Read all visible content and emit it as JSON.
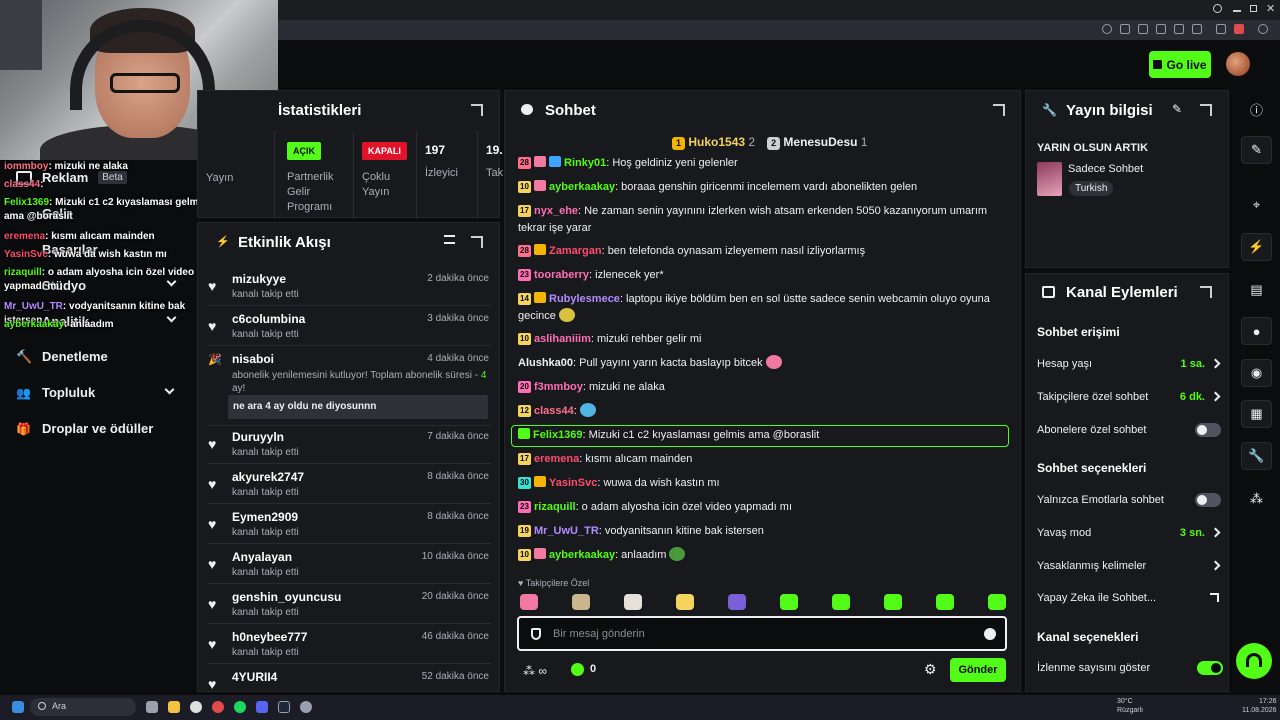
{
  "header": {
    "go_live": "Go live"
  },
  "sidebar": {
    "items": [
      {
        "label": "Reklam",
        "badge": "Beta"
      },
      {
        "label": "Gelir"
      },
      {
        "label": "Başarılar"
      },
      {
        "label": "Stüdyo"
      },
      {
        "label": "Analitik"
      },
      {
        "label": "Denetleme"
      },
      {
        "label": "Topluluk"
      },
      {
        "label": "Droplar ve ödüller"
      }
    ]
  },
  "overlay_chat": [
    {
      "name": "iommboy",
      "color": "#ff6e8a",
      "text": ": mizuki ne alaka"
    },
    {
      "name": "class44",
      "color": "#ff6e8a",
      "text": ":"
    },
    {
      "name": "Felix1369",
      "color": "#53fc18",
      "text": ": Mizuki c1 c2 kıyaslaması gelmis ama @boraslit"
    },
    {
      "name": "eremena",
      "color": "#ff4d6d",
      "text": ": kısmı alıcam mainden"
    },
    {
      "name": "YasinSvc",
      "color": "#ff4d6d",
      "text": ": wuwa da wish kastın mı"
    },
    {
      "name": "rizaquill",
      "color": "#53fc18",
      "text": ": o adam alyosha icin özel video yapmadı mı"
    },
    {
      "name": "Mr_UwU_TR",
      "color": "#b18cff",
      "text": ": vodyanitsanın kitine bak istersen"
    },
    {
      "name": "ayberkaakay",
      "color": "#53fc18",
      "text": ": anlaadım"
    }
  ],
  "stats": {
    "title": "İstatistikleri",
    "yayin_label": "Yayın",
    "partner": {
      "badge": "AÇIK",
      "label": "Partnerlik Gelir Programı"
    },
    "multi": {
      "badge": "KAPALI",
      "label": "Çoklu Yayın"
    },
    "viewers": {
      "value": "197",
      "label": "İzleyici"
    },
    "extra": {
      "value": "19.",
      "label": "Tak"
    }
  },
  "activity": {
    "title": "Etkinlik Akışı",
    "items": [
      {
        "user": "mizukyye",
        "sub": "kanalı takip etti",
        "time": "2 dakika önce"
      },
      {
        "user": "c6columbina",
        "sub": "kanalı takip etti",
        "time": "3 dakika önce"
      },
      {
        "user": "nisaboi",
        "sub": "abonelik yenilemesini kutluyor! Toplam abonelik süresi - ",
        "sub_highlight": "4",
        "sub_tail": "ay!",
        "message": "ne ara 4 ay oldu ne diyosunnn",
        "time": "4 dakika önce"
      },
      {
        "user": "Duruyyln",
        "sub": "kanalı takip etti",
        "time": "7 dakika önce"
      },
      {
        "user": "akyurek2747",
        "sub": "kanalı takip etti",
        "time": "8 dakika önce"
      },
      {
        "user": "Eymen2909",
        "sub": "kanalı takip etti",
        "time": "8 dakika önce"
      },
      {
        "user": "Anyalayan",
        "sub": "kanalı takip etti",
        "time": "10 dakika önce"
      },
      {
        "user": "genshin_oyuncusu",
        "sub": "kanalı takip etti",
        "time": "20 dakika önce"
      },
      {
        "user": "h0neybee777",
        "sub": "kanalı takip etti",
        "time": "46 dakika önce"
      },
      {
        "user": "4YURII4",
        "sub": "",
        "time": "52 dakika önce"
      }
    ]
  },
  "chat": {
    "title": "Sohbet",
    "top_gifters": [
      {
        "rank": "1",
        "name": "Huko1543",
        "count": "2"
      },
      {
        "rank": "2",
        "name": "MenesuDesu",
        "count": "1"
      }
    ],
    "messages": [
      {
        "level": "28",
        "lvl_color": "#ff6e8a",
        "name": "Rinky01",
        "name_color": "#53fc18",
        "text": ": Hoş geldiniz yeni gelenler"
      },
      {
        "level": "10",
        "lvl_color": "#f4d35e",
        "name": "ayberkaakay",
        "name_color": "#53fc18",
        "text": ": boraaa genshin giricenmi incelemem vardı abonelikten gelen"
      },
      {
        "level": "17",
        "lvl_color": "#f4d35e",
        "name": "nyx_ehe",
        "name_color": "#ff6eb4",
        "text": ": Ne zaman senin yayınını izlerken wish atsam erkenden 5050 kazanıyorum umarım tekrar işe yarar"
      },
      {
        "level": "28",
        "lvl_color": "#ff6e8a",
        "name": "Zamargan",
        "name_color": "#ff4d6d",
        "text": ": ben telefonda oynasam izleyemem nasıl izliyorlarmış"
      },
      {
        "level": "23",
        "lvl_color": "#ff6eb4",
        "name": "tooraberry",
        "name_color": "#ff6eb4",
        "text": ": izlenecek yer*"
      },
      {
        "level": "14",
        "lvl_color": "#f4d35e",
        "name": "Rubylesmece",
        "name_color": "#b18cff",
        "text": ": laptopu ikiye böldüm ben en sol üstte sadece senin webcamin oluyo oyuna gecince"
      },
      {
        "level": "10",
        "lvl_color": "#f4d35e",
        "name": "aslihaniiim",
        "name_color": "#ff6eb4",
        "text": ": mizuki rehber gelir mi"
      },
      {
        "level": "",
        "lvl_color": "",
        "name": "Alushka00",
        "name_color": "#efeff1",
        "text": ": Pull yayını yarın kacta baslayıp bitcek"
      },
      {
        "level": "20",
        "lvl_color": "#ff6eb4",
        "name": "f3mmboy",
        "name_color": "#ff6eb4",
        "text": ": mizuki ne alaka"
      },
      {
        "level": "12",
        "lvl_color": "#f4d35e",
        "name": "class44",
        "name_color": "#ff6e8a",
        "text": ":"
      },
      {
        "level": "",
        "lvl_color": "",
        "name": "Felix1369",
        "name_color": "#53fc18",
        "text": ": Mizuki c1 c2 kıyaslaması gelmis ama @boraslit"
      },
      {
        "level": "17",
        "lvl_color": "#f4d35e",
        "name": "eremena",
        "name_color": "#ff4d6d",
        "text": ": kısmı alıcam mainden"
      },
      {
        "level": "30",
        "lvl_color": "#3ee0d0",
        "name": "YasinSvc",
        "name_color": "#ff4d6d",
        "text": ": wuwa da wish kastın mı"
      },
      {
        "level": "23",
        "lvl_color": "#ff6eb4",
        "name": "rizaquill",
        "name_color": "#53fc18",
        "text": ": o adam alyosha icin özel video yapmadı mı"
      },
      {
        "level": "19",
        "lvl_color": "#f4d35e",
        "name": "Mr_UwU_TR",
        "name_color": "#b18cff",
        "text": ": vodyanitsanın kitine bak istersen"
      },
      {
        "level": "10",
        "lvl_color": "#f4d35e",
        "name": "ayberkaakay",
        "name_color": "#53fc18",
        "text": ": anlaadım"
      }
    ],
    "followers_only_label": "Takipçilere Özel",
    "input_placeholder": "Bir mesaj gönderin",
    "points": "0",
    "send": "Gönder"
  },
  "stream_info": {
    "title": "Yayın bilgisi",
    "stream_title": "YARIN OLSUN ARTIK",
    "category": "Sadece Sohbet",
    "language": "Turkish"
  },
  "channel_actions": {
    "title": "Kanal Eylemleri",
    "chat_access_title": "Sohbet erişimi",
    "account_age": {
      "label": "Hesap yaşı",
      "value": "1 sa."
    },
    "followers_chat": {
      "label": "Takipçilere özel sohbet",
      "value": "6 dk."
    },
    "subs_chat": {
      "label": "Abonelere özel sohbet"
    },
    "chat_options_title": "Sohbet seçenekleri",
    "emote_only": {
      "label": "Yalnızca Emotlarla sohbet"
    },
    "slow_mode": {
      "label": "Yavaş mod",
      "value": "3 sn."
    },
    "banned_words": {
      "label": "Yasaklanmış kelimeler"
    },
    "ai_chat": {
      "label": "Yapay Zeka ile Sohbet..."
    },
    "channel_options_title": "Kanal seçenekleri",
    "show_viewers": {
      "label": "İzlenme sayısını göster"
    }
  },
  "taskbar": {
    "search": "Ara",
    "weather": "30°C",
    "weather_sub": "Rüzgarlı",
    "time": "17:26",
    "date": "11.08.2026"
  },
  "colors": {
    "accent": "#53fc18",
    "panel": "#18191d",
    "bg": "#0b0c0e"
  }
}
